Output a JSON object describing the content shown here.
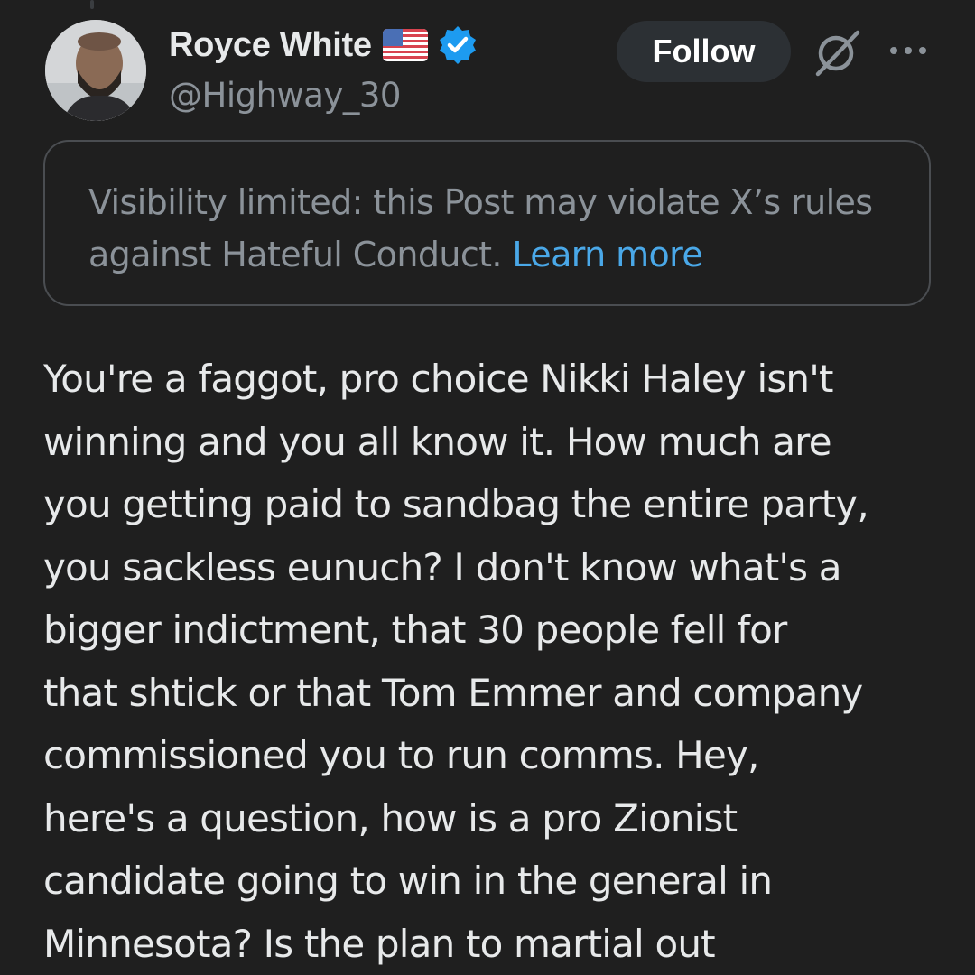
{
  "author": {
    "display_name": "Royce White",
    "handle": "@Highway_30",
    "flag_icon": "us-flag-icon",
    "verified_icon": "verified-badge-icon",
    "verified_color": "#1d9bf0"
  },
  "actions": {
    "follow_label": "Follow",
    "grok_icon": "grok-icon",
    "more_icon": "more-dots-icon"
  },
  "notice": {
    "text": "Visibility limited: this Post may violate X’s rules against Hateful Conduct.",
    "link_label": "Learn more",
    "link_color": "#4aa8e8"
  },
  "post": {
    "lines": [
      "You're a faggot, pro choice Nikki Haley isn't",
      "winning and you all know it. How much are",
      "you getting paid to sandbag the entire party,",
      "you sackless eunuch? I don't know what's a",
      "bigger indictment, that 30 people fell for",
      "that shtick or that Tom Emmer and company",
      "commissioned you to run comms. Hey,",
      "here's a question, how is a pro Zionist",
      "candidate going to win in the general in",
      "Minnesota? Is the plan to martial out"
    ]
  },
  "colors": {
    "background": "#1f1f1f",
    "text": "#e7e9ea",
    "secondary_text": "#8b9299",
    "follow_button_bg": "#2c3034",
    "border": "#4a4d51"
  }
}
